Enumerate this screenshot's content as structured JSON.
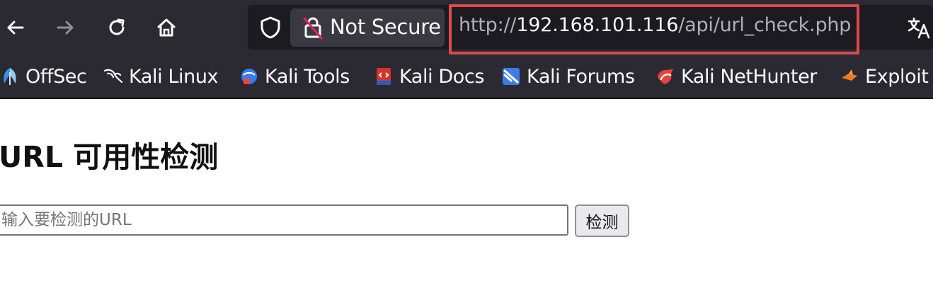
{
  "browser": {
    "security_label": "Not Secure",
    "url": {
      "scheme": "http://",
      "host": "192.168.101.116",
      "path": "/api/url_check.php"
    },
    "highlight_color": "#e0484a",
    "toolbar_color": "#2b2a33"
  },
  "bookmarks": [
    {
      "label": "OffSec",
      "icon": "offsec-icon"
    },
    {
      "label": "Kali Linux",
      "icon": "kali-linux-icon"
    },
    {
      "label": "Kali Tools",
      "icon": "kali-tools-icon"
    },
    {
      "label": "Kali Docs",
      "icon": "kali-docs-icon"
    },
    {
      "label": "Kali Forums",
      "icon": "kali-forums-icon"
    },
    {
      "label": "Kali NetHunter",
      "icon": "kali-nethunter-icon"
    },
    {
      "label": "Exploit",
      "icon": "exploit-db-icon"
    }
  ],
  "page": {
    "title": "URL 可用性检测",
    "input_placeholder": "输入要检测的URL",
    "input_value": "",
    "button_label": "检测"
  }
}
